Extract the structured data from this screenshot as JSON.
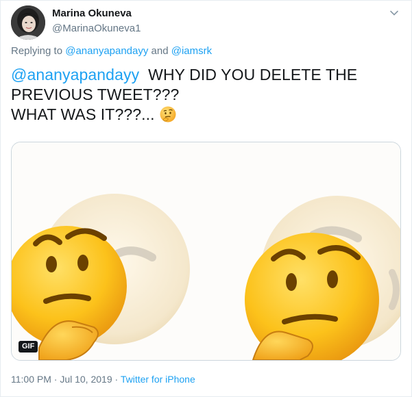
{
  "tweet": {
    "author": {
      "name": "Marina Okuneva",
      "handle": "@MarinaOkuneva1"
    },
    "replying": {
      "prefix": "Replying to ",
      "users": [
        "@ananyapandayy",
        "@iamsrk"
      ],
      "conjunction": " and "
    },
    "text": {
      "mention": "@ananyapandayy",
      "line1": "  WHY DID YOU DELETE THE",
      "line2": "PREVIOUS TWEET???",
      "line3": "WHAT WAS IT???..."
    },
    "emoji_inline": "thinking-face",
    "media": {
      "type": "gif",
      "badge": "GIF",
      "content": "thinking-face emojis"
    },
    "timestamp": "11:00 PM · Jul 10, 2019",
    "separator": " · ",
    "source": "Twitter for iPhone"
  },
  "colors": {
    "link": "#1da1f2",
    "text": "#14171a",
    "muted": "#657786",
    "border": "#ccd6dd"
  },
  "icons": {
    "caret": "chevron-down-icon",
    "avatar": "avatar"
  }
}
